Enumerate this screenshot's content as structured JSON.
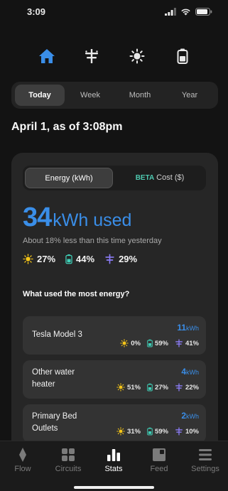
{
  "status_bar": {
    "time": "3:09"
  },
  "top_nav": {
    "items": [
      {
        "icon": "home-icon",
        "active": true
      },
      {
        "icon": "utility-pole-icon",
        "active": false
      },
      {
        "icon": "sun-icon",
        "active": false
      },
      {
        "icon": "battery-icon",
        "active": false
      }
    ]
  },
  "period_selector": {
    "options": [
      "Today",
      "Week",
      "Month",
      "Year"
    ],
    "selected": "Today"
  },
  "date_heading": "April 1, as of 3:08pm",
  "unit_toggle": {
    "energy_label": "Energy (kWh)",
    "beta_tag": "BETA",
    "cost_label": "Cost ($)",
    "selected": "Energy (kWh)"
  },
  "summary": {
    "value": "34",
    "unit": "kWh used",
    "comparison": "About 18% less than this time yesterday",
    "mix": {
      "solar": "27%",
      "battery": "44%",
      "grid": "29%"
    }
  },
  "breakdown": {
    "heading": "What used the most energy?",
    "items": [
      {
        "name": "Tesla Model 3",
        "value": "11",
        "unit": "kWh",
        "solar": "0%",
        "battery": "59%",
        "grid": "41%"
      },
      {
        "name": "Other water heater",
        "value": "4",
        "unit": "kWh",
        "solar": "51%",
        "battery": "27%",
        "grid": "22%"
      },
      {
        "name": "Primary Bed Outlets",
        "value": "2",
        "unit": "kWh",
        "solar": "31%",
        "battery": "59%",
        "grid": "10%"
      }
    ]
  },
  "tab_bar": {
    "tabs": [
      {
        "label": "Flow",
        "icon": "flow-icon"
      },
      {
        "label": "Circuits",
        "icon": "circuits-icon"
      },
      {
        "label": "Stats",
        "icon": "stats-icon"
      },
      {
        "label": "Feed",
        "icon": "feed-icon"
      },
      {
        "label": "Settings",
        "icon": "settings-icon"
      }
    ],
    "selected": "Stats"
  },
  "colors": {
    "accent_blue": "#3a8ee8",
    "solar_yellow": "#f5c518",
    "battery_teal": "#3fd0b8",
    "grid_purple": "#8b7cf6",
    "beta_teal": "#4ec9b0"
  }
}
